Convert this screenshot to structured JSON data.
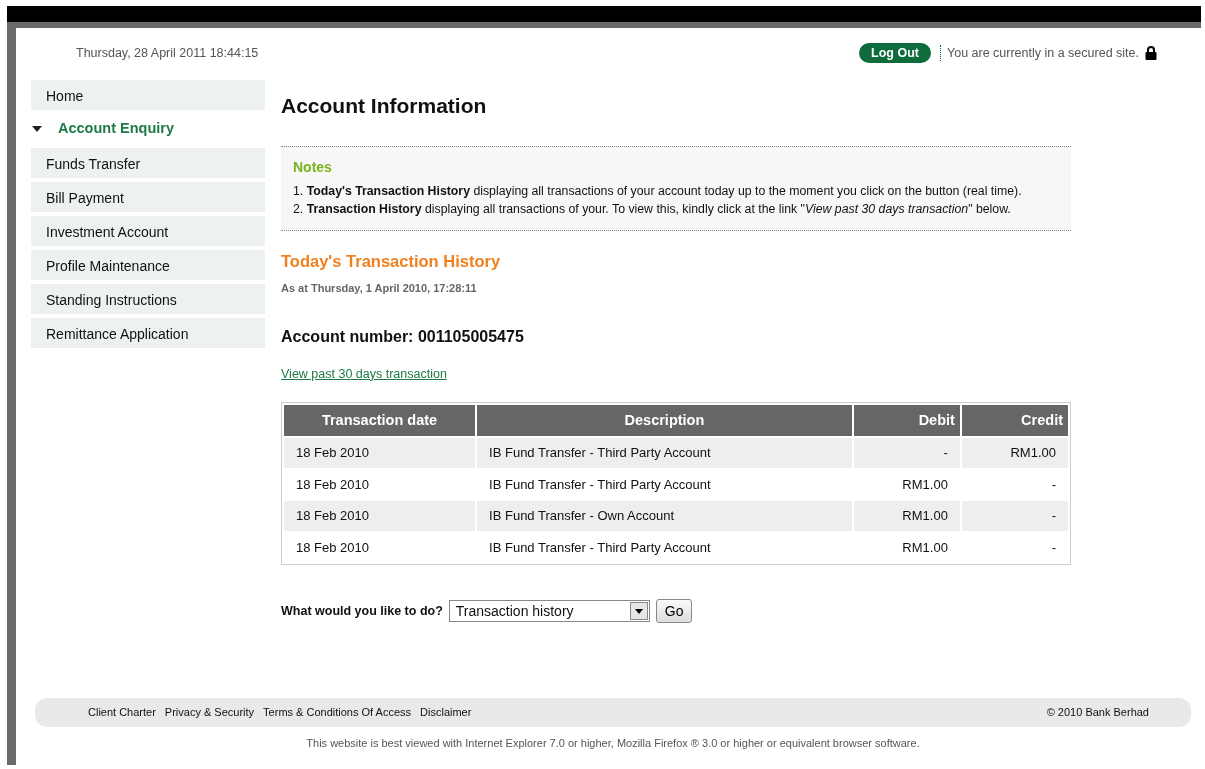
{
  "header": {
    "datetime": "Thursday, 28 April 2011 18:44:15",
    "logout_button": "Log Out",
    "secure_notice": "You are currently in a secured site."
  },
  "sidebar": {
    "items": [
      {
        "label": "Home",
        "kind": "link"
      },
      {
        "label": "Account Enquiry",
        "kind": "section",
        "expanded": true
      },
      {
        "label": "Funds Transfer",
        "kind": "link"
      },
      {
        "label": "Bill Payment",
        "kind": "link"
      },
      {
        "label": "Investment Account",
        "kind": "link"
      },
      {
        "label": "Profile Maintenance",
        "kind": "link"
      },
      {
        "label": "Standing Instructions",
        "kind": "link"
      },
      {
        "label": "Remittance Application",
        "kind": "link"
      }
    ]
  },
  "page_title": "Account Information",
  "notes": {
    "title": "Notes",
    "lines": [
      "1. **Today's Transaction History** displaying all transactions of your account today up to the moment you click on the button (real time).",
      "2. **Transaction History** displaying all transactions of your. To view this, kindly click at the link \"*View past 30 days transaction*\" below."
    ]
  },
  "section_title": "Today's Transaction History",
  "as_at": "As at Thursday, 1 April 2010, 17:28:11",
  "account_number": "Account number: 001105005475",
  "history_link": "View past 30 days transaction",
  "table": {
    "columns": [
      "Transaction date",
      "Description",
      "Debit",
      "Credit"
    ],
    "rows": [
      [
        "18 Feb 2010",
        "IB Fund Transfer - Third Party Account",
        "-",
        "RM1.00"
      ],
      [
        "18 Feb 2010",
        "IB Fund Transfer - Third Party Account",
        "RM1.00",
        "-"
      ],
      [
        "18 Feb 2010",
        "IB Fund Transfer - Own Account",
        "RM1.00",
        "-"
      ],
      [
        "18 Feb 2010",
        "IB Fund Transfer - Third Party Account",
        "RM1.00",
        "-"
      ]
    ]
  },
  "action": {
    "label": "What would you like to do?",
    "select_value": "Transaction history",
    "go_button": "Go"
  },
  "footer": {
    "links": [
      "Client Charter",
      "Privacy & Security",
      "Terms & Conditions Of Access",
      "Disclaimer"
    ],
    "copyright": "© 2010 Bank Berhad",
    "browser_note": "This website is best viewed with Internet Explorer 7.0 or higher, Mozilla Firefox ® 3.0 or higher or equivalent browser software."
  }
}
